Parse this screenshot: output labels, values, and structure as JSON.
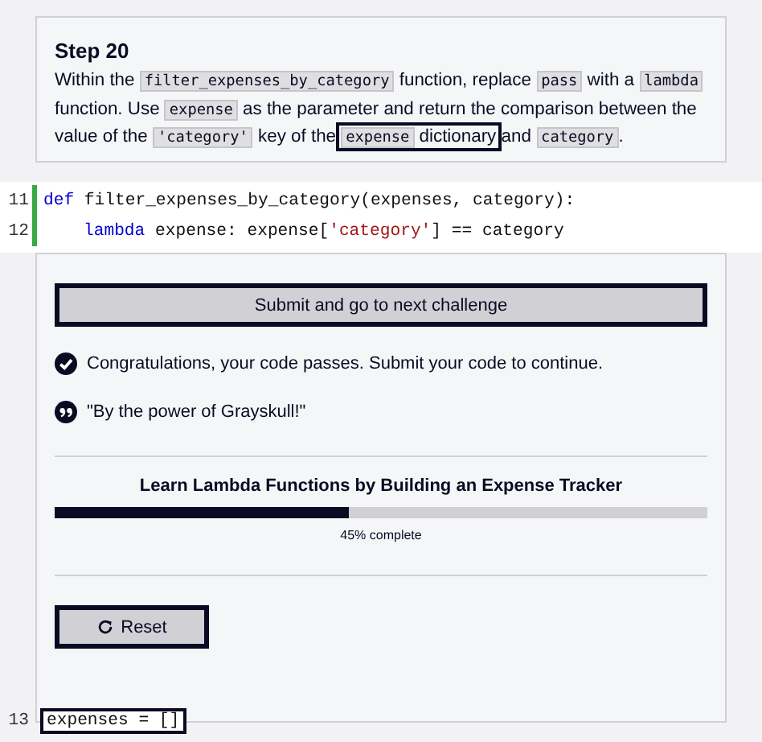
{
  "step": {
    "title": "Step 20",
    "instruction": [
      {
        "kind": "text",
        "text": "Within the "
      },
      {
        "kind": "code",
        "text": "filter_expenses_by_category"
      },
      {
        "kind": "text",
        "text": " function, replace "
      },
      {
        "kind": "code",
        "text": "pass"
      },
      {
        "kind": "text",
        "text": " with a "
      },
      {
        "kind": "code",
        "text": "lambda"
      },
      {
        "kind": "text",
        "text": " function. Use "
      },
      {
        "kind": "code",
        "text": "expense"
      },
      {
        "kind": "text",
        "text": " as the parameter and return the comparison between the value of the "
      },
      {
        "kind": "code",
        "text": "'category'"
      },
      {
        "kind": "text",
        "text": " key of the "
      },
      {
        "kind": "outlined",
        "parts": [
          {
            "kind": "code",
            "text": "expense"
          },
          {
            "kind": "text",
            "text": " dictionary"
          }
        ]
      },
      {
        "kind": "text",
        "text": " and "
      },
      {
        "kind": "code",
        "text": "category"
      },
      {
        "kind": "text",
        "text": "."
      }
    ]
  },
  "code_top": [
    {
      "number": "11",
      "modified": true,
      "outlined": false,
      "indented": false,
      "tokens": [
        {
          "kind": "keyword",
          "text": "def"
        },
        {
          "kind": "plain",
          "text": " filter_expenses_by_category(expenses, category):"
        }
      ]
    },
    {
      "number": "12",
      "modified": true,
      "outlined": false,
      "indented": true,
      "tokens": [
        {
          "kind": "keyword",
          "text": "lambda"
        },
        {
          "kind": "plain",
          "text": " expense: expense["
        },
        {
          "kind": "string",
          "text": "'category'"
        },
        {
          "kind": "plain",
          "text": "] == category"
        }
      ]
    }
  ],
  "panel": {
    "submit_button": "Submit and go to next challenge",
    "messages": [
      {
        "kind": "check",
        "text": "Congratulations, your code passes. Submit your code to continue."
      },
      {
        "kind": "quote",
        "text": "\"By the power of Grayskull!\""
      }
    ],
    "progress": {
      "title": "Learn Lambda Functions by Building an Expense Tracker",
      "level": 0.45,
      "reading": "45% complete"
    },
    "reset_button": "Reset"
  },
  "code_bottom": [
    {
      "number": "13",
      "modified": false,
      "outlined": true,
      "tokens": [
        {
          "kind": "plain",
          "text": "expenses = []"
        }
      ]
    }
  ]
}
